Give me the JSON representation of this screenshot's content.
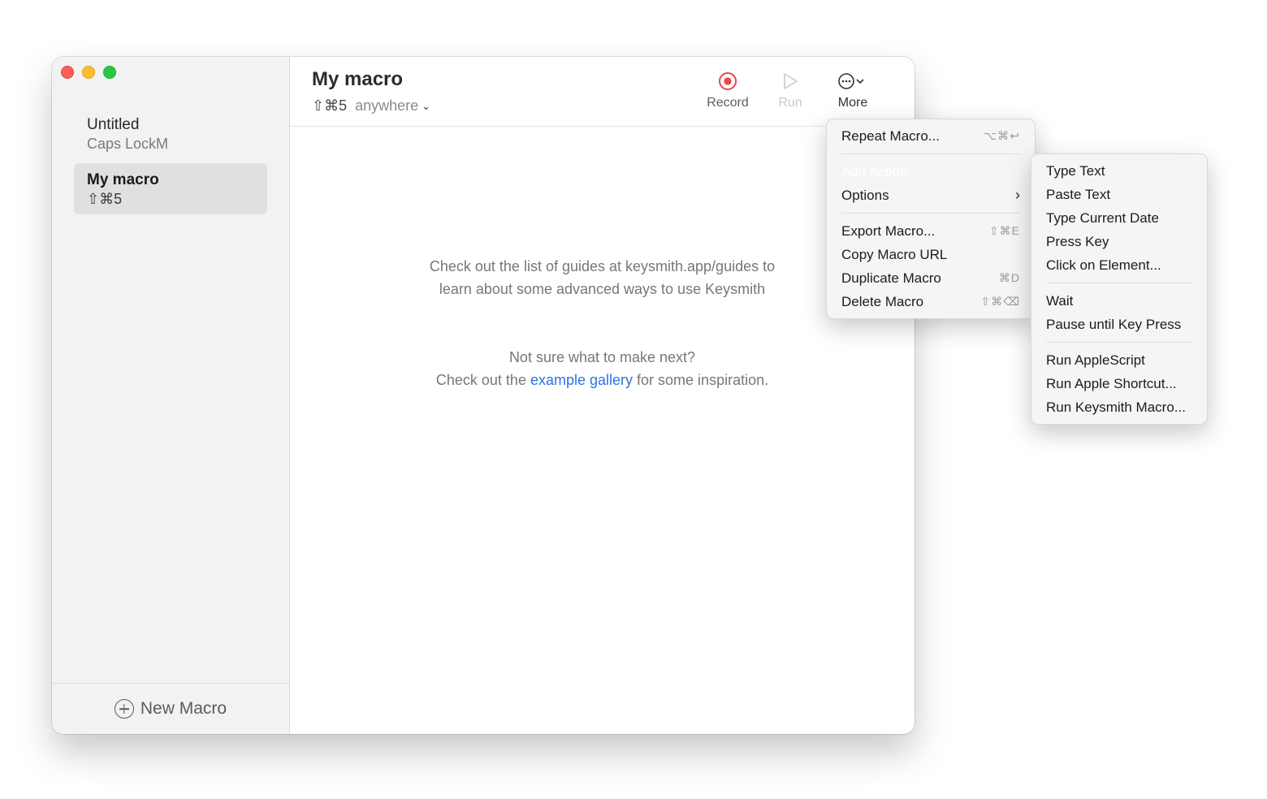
{
  "sidebar": {
    "macros": [
      {
        "name": "Untitled",
        "shortcut": "Caps LockM"
      },
      {
        "name": "My macro",
        "shortcut": "⇧⌘5"
      }
    ],
    "new_macro_label": "New Macro"
  },
  "header": {
    "title": "My macro",
    "shortcut": "⇧⌘5",
    "scope": "anywhere",
    "record_label": "Record",
    "run_label": "Run",
    "more_label": "More"
  },
  "content": {
    "guides_line1": "Check out the list of guides at keysmith.app/guides to",
    "guides_line2": "learn about some advanced ways to use Keysmith",
    "inspire_line1": "Not sure what to make next?",
    "inspire_pre": "Check out the ",
    "inspire_link": "example gallery",
    "inspire_post": " for some inspiration."
  },
  "more_menu": {
    "repeat": {
      "label": "Repeat Macro...",
      "shortcut": "⌥⌘↩"
    },
    "add_action": {
      "label": "Add Action"
    },
    "options": {
      "label": "Options"
    },
    "export": {
      "label": "Export Macro...",
      "shortcut": "⇧⌘E"
    },
    "copy_url": {
      "label": "Copy Macro URL"
    },
    "duplicate": {
      "label": "Duplicate Macro",
      "shortcut": "⌘D"
    },
    "delete": {
      "label": "Delete Macro",
      "shortcut": "⇧⌘⌫"
    }
  },
  "add_action_menu": {
    "group1": [
      "Type Text",
      "Paste Text",
      "Type Current Date",
      "Press Key",
      "Click on Element..."
    ],
    "group2": [
      "Wait",
      "Pause until Key Press"
    ],
    "group3": [
      "Run AppleScript",
      "Run Apple Shortcut...",
      "Run Keysmith Macro..."
    ]
  },
  "colors": {
    "record_red": "#e5484d",
    "link_blue": "#2f73e0",
    "highlight_blue": "#2f73e0"
  }
}
